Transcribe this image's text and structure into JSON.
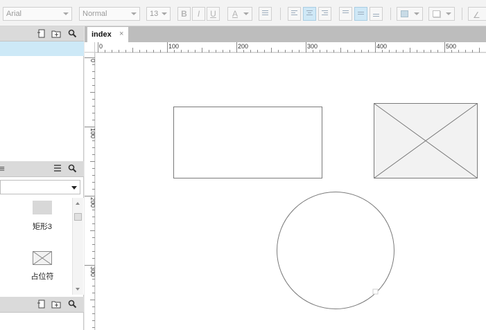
{
  "toolbar": {
    "font_family": "Arial",
    "font_style": "Normal",
    "font_size": "13",
    "bold_label": "B",
    "italic_label": "I",
    "underline_label": "U",
    "text_color_label": "A"
  },
  "tab": {
    "label": "index",
    "close": "×"
  },
  "ruler": {
    "horizontal": [
      "0",
      "100",
      "200",
      "300",
      "400",
      "500"
    ],
    "vertical": [
      "0",
      "100",
      "200",
      "300"
    ]
  },
  "library": {
    "items": [
      {
        "label": "矩形3"
      },
      {
        "label": "占位符"
      }
    ]
  },
  "colors": {
    "selection": "#cde9f7",
    "shape_stroke": "#7a7a7a",
    "placeholder_fill": "#f2f2f2"
  }
}
